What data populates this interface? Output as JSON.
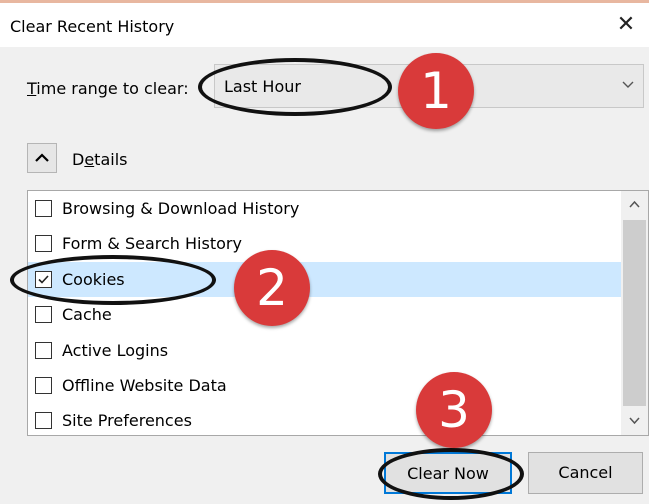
{
  "dialog": {
    "title": "Clear Recent History",
    "close_glyph": "✕"
  },
  "time_range": {
    "label_first": "T",
    "label_rest": "ime range to clear:",
    "selected": "Last Hour"
  },
  "details": {
    "label_first": "D",
    "label_mid": "e",
    "label_rest": "tails"
  },
  "items": [
    {
      "label": "Browsing & Download History",
      "checked": false
    },
    {
      "label": "Form & Search History",
      "checked": false
    },
    {
      "label": "Cookies",
      "checked": true
    },
    {
      "label": "Cache",
      "checked": false
    },
    {
      "label": "Active Logins",
      "checked": false
    },
    {
      "label": "Offline Website Data",
      "checked": false
    },
    {
      "label": "Site Preferences",
      "checked": false
    }
  ],
  "buttons": {
    "clear_now": "Clear Now",
    "cancel": "Cancel"
  },
  "annotations": {
    "step1": "1",
    "step2": "2",
    "step3": "3"
  },
  "colors": {
    "annotation_red": "#d93a3a",
    "selection_blue": "#cde8ff",
    "focus_blue": "#0078d7"
  }
}
